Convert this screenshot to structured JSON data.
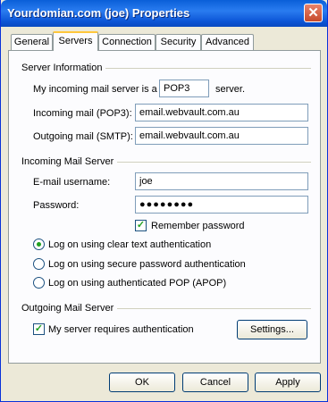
{
  "window": {
    "title": "Yourdomian.com (joe) Properties",
    "close_glyph": "✕"
  },
  "tabs": [
    {
      "label": "General"
    },
    {
      "label": "Servers"
    },
    {
      "label": "Connection"
    },
    {
      "label": "Security"
    },
    {
      "label": "Advanced"
    }
  ],
  "server_info": {
    "group_label": "Server Information",
    "prefix_text": "My incoming mail server is a",
    "server_type": "POP3",
    "suffix_text": "server.",
    "incoming_label": "Incoming mail (POP3):",
    "incoming_value": "email.webvault.com.au",
    "outgoing_label": "Outgoing mail (SMTP):",
    "outgoing_value": "email.webvault.com.au"
  },
  "incoming_server": {
    "group_label": "Incoming Mail Server",
    "username_label": "E-mail username:",
    "username_value": "joe",
    "password_label": "Password:",
    "password_value": "●●●●●●●●",
    "remember_label": "Remember password",
    "remember_checked": true,
    "auth_options": [
      {
        "label": "Log on using clear text authentication",
        "selected": true
      },
      {
        "label": "Log on using secure password authentication",
        "selected": false
      },
      {
        "label": "Log on using authenticated POP (APOP)",
        "selected": false
      }
    ]
  },
  "outgoing_server": {
    "group_label": "Outgoing Mail Server",
    "requires_auth_label": "My server requires authentication",
    "requires_auth_checked": true,
    "settings_label": "Settings..."
  },
  "footer": {
    "ok_label": "OK",
    "cancel_label": "Cancel",
    "apply_label": "Apply"
  },
  "colors": {
    "titlebar": "#0a5fd8",
    "dialog_bg": "#ece9d8",
    "check_green": "#21a121"
  }
}
